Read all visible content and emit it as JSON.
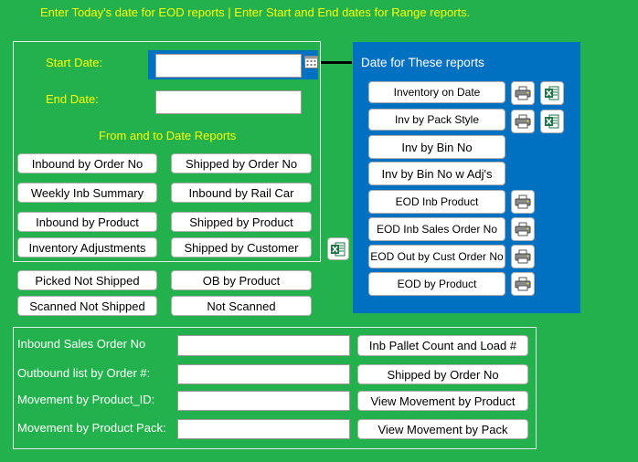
{
  "instructions": "Enter Today's date for EOD reports  | Enter Start and End dates for Range reports.",
  "date_panel": {
    "start_label": "Start Date:",
    "end_label": "End Date:",
    "start_value": "",
    "end_value": "",
    "section_title": "From and to Date Reports"
  },
  "range_buttons": {
    "inbound_by_order": "Inbound by Order No",
    "shipped_by_order": "Shipped by Order No",
    "weekly_inb_summary": "Weekly Inb Summary",
    "inbound_by_rail_car": "Inbound by Rail Car",
    "inbound_by_product": "Inbound by Product",
    "shipped_by_product": "Shipped by Product",
    "inventory_adjustments": "Inventory Adjustments",
    "shipped_by_customer": "Shipped by Customer"
  },
  "other_buttons": {
    "picked_not_shipped": "Picked Not Shipped",
    "ob_by_product": "OB by Product",
    "scanned_not_shipped": "Scanned Not Shipped",
    "not_scanned": "Not Scanned"
  },
  "eod_panel": {
    "title": "Date for These reports",
    "inventory_on_date": "Inventory on Date",
    "inv_by_pack_style": "Inv by Pack Style",
    "inv_by_bin_no": "Inv by Bin No",
    "inv_by_bin_no_adj": "Inv by Bin No w Adj's",
    "eod_inb_product": "EOD Inb Product",
    "eod_inb_sales_order": "EOD Inb Sales Order No",
    "eod_out_by_cust_order": "EOD Out by Cust Order No",
    "eod_by_product": "EOD by Product"
  },
  "lookup": {
    "inbound_sales_order_label": "Inbound Sales Order No",
    "outbound_list_label": "Outbound list by Order #:",
    "movement_product_id_label": "Movement by Product_ID:",
    "movement_product_pack_label": "Movement by Product Pack:",
    "inb_pallet_count_button": "Inb Pallet Count and Load #",
    "shipped_by_order_button": "Shipped by Order No",
    "view_movement_product_button": "View Movement  by Product",
    "view_movement_pack_button": "View Movement  by Pack"
  },
  "colors": {
    "background": "#22b14c",
    "label_yellow": "#ffff00",
    "panel_blue": "#0070c0",
    "excel_green": "#217346"
  },
  "icons": {
    "calendar": "calendar-icon",
    "printer": "printer-icon",
    "excel": "excel-icon"
  }
}
